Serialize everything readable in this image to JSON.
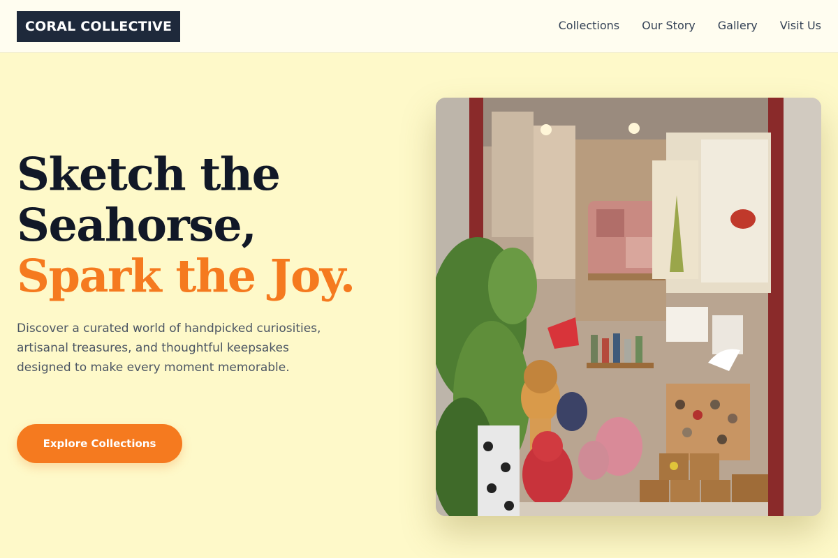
{
  "header": {
    "brand": "CORAL COLLECTIVE",
    "nav": [
      {
        "label": "Collections"
      },
      {
        "label": "Our Story"
      },
      {
        "label": "Gallery"
      },
      {
        "label": "Visit Us"
      }
    ]
  },
  "hero": {
    "title_line1": "Sketch the",
    "title_line2": "Seahorse,",
    "title_accent": "Spark the Joy.",
    "description": "Discover a curated world of handpicked curiosities, artisanal treasures, and thoughtful keepsakes designed to make every moment memorable.",
    "cta_label": "Explore Collections",
    "image_alt": "Shop window display with plush toys, pillows, bird art and wooden shelves"
  },
  "colors": {
    "background": "#fef9c9",
    "accent": "#f57a1f",
    "brand_dark": "#1e293b"
  }
}
